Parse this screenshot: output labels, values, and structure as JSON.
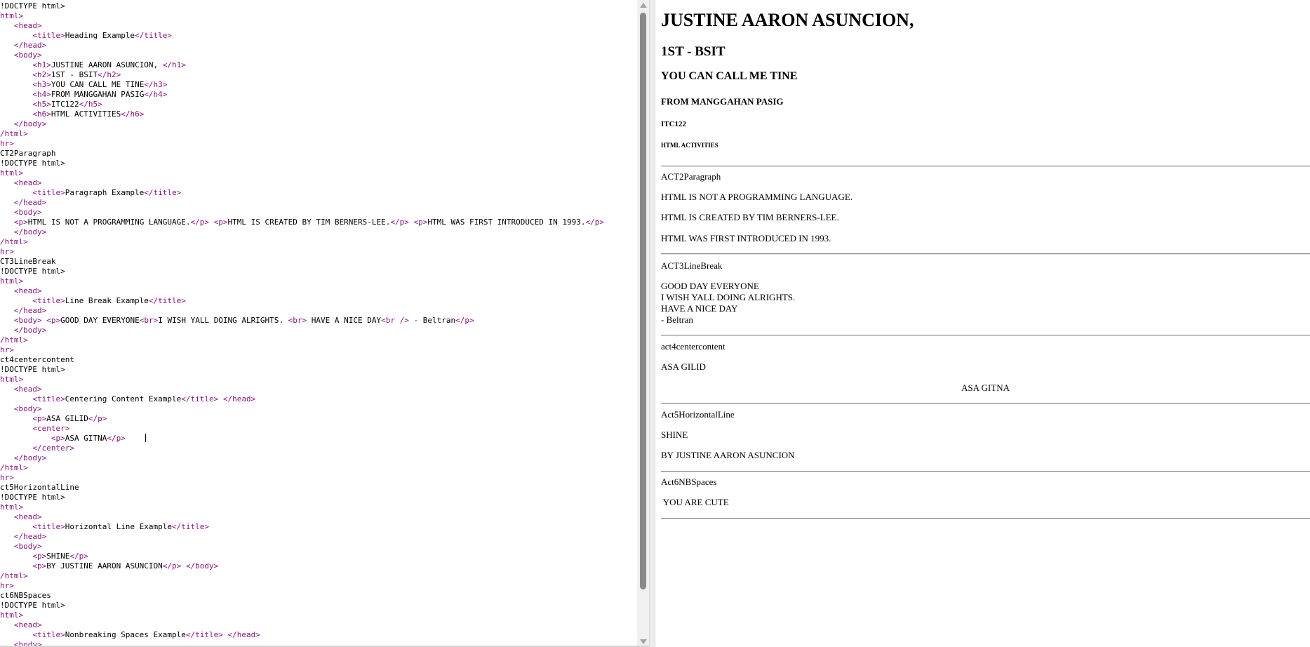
{
  "editor": {
    "lines": [
      [
        {
          "t": "!DOCTYPE html>",
          "c": "txt"
        }
      ],
      [
        {
          "t": "html>",
          "c": "tag"
        }
      ],
      [
        {
          "t": "   ",
          "c": "txt"
        },
        {
          "t": "<head>",
          "c": "tag"
        }
      ],
      [
        {
          "t": "       ",
          "c": "txt"
        },
        {
          "t": "<title>",
          "c": "tag"
        },
        {
          "t": "Heading Example",
          "c": "txt"
        },
        {
          "t": "</title>",
          "c": "tag"
        }
      ],
      [
        {
          "t": "   ",
          "c": "txt"
        },
        {
          "t": "</head>",
          "c": "tag"
        }
      ],
      [
        {
          "t": "   ",
          "c": "txt"
        },
        {
          "t": "<body>",
          "c": "tag"
        }
      ],
      [
        {
          "t": "       ",
          "c": "txt"
        },
        {
          "t": "<h1>",
          "c": "tag"
        },
        {
          "t": "JUSTINE AARON ASUNCION, ",
          "c": "txt"
        },
        {
          "t": "</h1>",
          "c": "tag"
        }
      ],
      [
        {
          "t": "       ",
          "c": "txt"
        },
        {
          "t": "<h2>",
          "c": "tag"
        },
        {
          "t": "1ST - BSIT",
          "c": "txt"
        },
        {
          "t": "</h2>",
          "c": "tag"
        }
      ],
      [
        {
          "t": "       ",
          "c": "txt"
        },
        {
          "t": "<h3>",
          "c": "tag"
        },
        {
          "t": "YOU CAN CALL ME TINE",
          "c": "txt"
        },
        {
          "t": "</h3>",
          "c": "tag"
        }
      ],
      [
        {
          "t": "       ",
          "c": "txt"
        },
        {
          "t": "<h4>",
          "c": "tag"
        },
        {
          "t": "FROM MANGGAHAN PASIG",
          "c": "txt"
        },
        {
          "t": "</h4>",
          "c": "tag"
        }
      ],
      [
        {
          "t": "       ",
          "c": "txt"
        },
        {
          "t": "<h5>",
          "c": "tag"
        },
        {
          "t": "ITC122",
          "c": "txt"
        },
        {
          "t": "</h5>",
          "c": "tag"
        }
      ],
      [
        {
          "t": "       ",
          "c": "txt"
        },
        {
          "t": "<h6>",
          "c": "tag"
        },
        {
          "t": "HTML ACTIVITIES",
          "c": "txt"
        },
        {
          "t": "</h6>",
          "c": "tag"
        }
      ],
      [
        {
          "t": "   ",
          "c": "txt"
        },
        {
          "t": "</body>",
          "c": "tag"
        }
      ],
      [
        {
          "t": "/html>",
          "c": "tag"
        }
      ],
      [
        {
          "t": "hr>",
          "c": "tag"
        }
      ],
      [
        {
          "t": "CT2Paragraph",
          "c": "txt"
        }
      ],
      [
        {
          "t": "!DOCTYPE html>",
          "c": "txt"
        }
      ],
      [
        {
          "t": "html>",
          "c": "tag"
        }
      ],
      [
        {
          "t": "   ",
          "c": "txt"
        },
        {
          "t": "<head>",
          "c": "tag"
        }
      ],
      [
        {
          "t": "       ",
          "c": "txt"
        },
        {
          "t": "<title>",
          "c": "tag"
        },
        {
          "t": "Paragraph Example",
          "c": "txt"
        },
        {
          "t": "</title>",
          "c": "tag"
        }
      ],
      [
        {
          "t": "   ",
          "c": "txt"
        },
        {
          "t": "</head>",
          "c": "tag"
        }
      ],
      [
        {
          "t": "   ",
          "c": "txt"
        },
        {
          "t": "<body>",
          "c": "tag"
        }
      ],
      [
        {
          "t": "   ",
          "c": "txt"
        },
        {
          "t": "<p>",
          "c": "tag"
        },
        {
          "t": "HTML IS NOT A PROGRAMMING LANGUAGE.",
          "c": "txt"
        },
        {
          "t": "</p>",
          "c": "tag"
        },
        {
          "t": " ",
          "c": "txt"
        },
        {
          "t": "<p>",
          "c": "tag"
        },
        {
          "t": "HTML IS CREATED BY TIM BERNERS-LEE.",
          "c": "txt"
        },
        {
          "t": "</p>",
          "c": "tag"
        },
        {
          "t": " ",
          "c": "txt"
        },
        {
          "t": "<p>",
          "c": "tag"
        },
        {
          "t": "HTML WAS FIRST INTRODUCED IN 1993.",
          "c": "txt"
        },
        {
          "t": "</p>",
          "c": "tag"
        }
      ],
      [
        {
          "t": "   ",
          "c": "txt"
        },
        {
          "t": "</body>",
          "c": "tag"
        }
      ],
      [
        {
          "t": "/html>",
          "c": "tag"
        }
      ],
      [
        {
          "t": "hr>",
          "c": "tag"
        }
      ],
      [
        {
          "t": "CT3LineBreak",
          "c": "txt"
        }
      ],
      [
        {
          "t": "!DOCTYPE html>",
          "c": "txt"
        }
      ],
      [
        {
          "t": "html>",
          "c": "tag"
        }
      ],
      [
        {
          "t": "   ",
          "c": "txt"
        },
        {
          "t": "<head>",
          "c": "tag"
        }
      ],
      [
        {
          "t": "       ",
          "c": "txt"
        },
        {
          "t": "<title>",
          "c": "tag"
        },
        {
          "t": "Line Break Example",
          "c": "txt"
        },
        {
          "t": "</title>",
          "c": "tag"
        }
      ],
      [
        {
          "t": "   ",
          "c": "txt"
        },
        {
          "t": "</head>",
          "c": "tag"
        }
      ],
      [
        {
          "t": "   ",
          "c": "txt"
        },
        {
          "t": "<body>",
          "c": "tag"
        },
        {
          "t": " ",
          "c": "txt"
        },
        {
          "t": "<p>",
          "c": "tag"
        },
        {
          "t": "GOOD DAY EVERYONE",
          "c": "txt"
        },
        {
          "t": "<br>",
          "c": "tag"
        },
        {
          "t": "I WISH YALL DOING ALRIGHTS. ",
          "c": "txt"
        },
        {
          "t": "<br>",
          "c": "tag"
        },
        {
          "t": " HAVE A NICE DAY",
          "c": "txt"
        },
        {
          "t": "<br />",
          "c": "tag"
        },
        {
          "t": " - Beltran",
          "c": "txt"
        },
        {
          "t": "</p>",
          "c": "tag"
        }
      ],
      [
        {
          "t": "   ",
          "c": "txt"
        },
        {
          "t": "</body>",
          "c": "tag"
        }
      ],
      [
        {
          "t": "/html>",
          "c": "tag"
        }
      ],
      [
        {
          "t": "hr>",
          "c": "tag"
        }
      ],
      [
        {
          "t": "ct4centercontent",
          "c": "txt"
        }
      ],
      [
        {
          "t": "!DOCTYPE html>",
          "c": "txt"
        }
      ],
      [
        {
          "t": "html>",
          "c": "tag"
        }
      ],
      [
        {
          "t": "   ",
          "c": "txt"
        },
        {
          "t": "<head>",
          "c": "tag"
        }
      ],
      [
        {
          "t": "       ",
          "c": "txt"
        },
        {
          "t": "<title>",
          "c": "tag"
        },
        {
          "t": "Centering Content Example",
          "c": "txt"
        },
        {
          "t": "</title>",
          "c": "tag"
        },
        {
          "t": " ",
          "c": "txt"
        },
        {
          "t": "</head>",
          "c": "tag"
        }
      ],
      [
        {
          "t": "   ",
          "c": "txt"
        },
        {
          "t": "<body>",
          "c": "tag"
        }
      ],
      [
        {
          "t": "       ",
          "c": "txt"
        },
        {
          "t": "<p>",
          "c": "tag"
        },
        {
          "t": "ASA GILID",
          "c": "txt"
        },
        {
          "t": "</p>",
          "c": "tag"
        }
      ],
      [
        {
          "t": "       ",
          "c": "txt"
        },
        {
          "t": "<center>",
          "c": "tag"
        }
      ],
      [
        {
          "t": "           ",
          "c": "txt"
        },
        {
          "t": "<p>",
          "c": "tag"
        },
        {
          "t": "ASA GITNA",
          "c": "txt"
        },
        {
          "t": "</p>",
          "c": "tag"
        },
        {
          "t": "CURSOR",
          "c": "cursor"
        }
      ],
      [
        {
          "t": "       ",
          "c": "txt"
        },
        {
          "t": "</center>",
          "c": "tag"
        }
      ],
      [
        {
          "t": "   ",
          "c": "txt"
        },
        {
          "t": "</body>",
          "c": "tag"
        }
      ],
      [
        {
          "t": "/html>",
          "c": "tag"
        }
      ],
      [
        {
          "t": "hr>",
          "c": "tag"
        }
      ],
      [
        {
          "t": "ct5HorizontalLine",
          "c": "txt"
        }
      ],
      [
        {
          "t": "!DOCTYPE html>",
          "c": "txt"
        }
      ],
      [
        {
          "t": "html>",
          "c": "tag"
        }
      ],
      [
        {
          "t": "   ",
          "c": "txt"
        },
        {
          "t": "<head>",
          "c": "tag"
        }
      ],
      [
        {
          "t": "       ",
          "c": "txt"
        },
        {
          "t": "<title>",
          "c": "tag"
        },
        {
          "t": "Horizontal Line Example",
          "c": "txt"
        },
        {
          "t": "</title>",
          "c": "tag"
        }
      ],
      [
        {
          "t": "   ",
          "c": "txt"
        },
        {
          "t": "</head>",
          "c": "tag"
        }
      ],
      [
        {
          "t": "   ",
          "c": "txt"
        },
        {
          "t": "<body>",
          "c": "tag"
        }
      ],
      [
        {
          "t": "       ",
          "c": "txt"
        },
        {
          "t": "<p>",
          "c": "tag"
        },
        {
          "t": "SHINE",
          "c": "txt"
        },
        {
          "t": "</p>",
          "c": "tag"
        }
      ],
      [
        {
          "t": "       ",
          "c": "txt"
        },
        {
          "t": "<p>",
          "c": "tag"
        },
        {
          "t": "BY JUSTINE AARON ASUNCION",
          "c": "txt"
        },
        {
          "t": "</p>",
          "c": "tag"
        },
        {
          "t": " ",
          "c": "txt"
        },
        {
          "t": "</body>",
          "c": "tag"
        }
      ],
      [
        {
          "t": "/html>",
          "c": "tag"
        }
      ],
      [
        {
          "t": "hr>",
          "c": "tag"
        }
      ],
      [
        {
          "t": "ct6NBSpaces",
          "c": "txt"
        }
      ],
      [
        {
          "t": "!DOCTYPE html>",
          "c": "txt"
        }
      ],
      [
        {
          "t": "html>",
          "c": "tag"
        }
      ],
      [
        {
          "t": "   ",
          "c": "txt"
        },
        {
          "t": "<head>",
          "c": "tag"
        }
      ],
      [
        {
          "t": "       ",
          "c": "txt"
        },
        {
          "t": "<title>",
          "c": "tag"
        },
        {
          "t": "Nonbreaking Spaces Example",
          "c": "txt"
        },
        {
          "t": "</title>",
          "c": "tag"
        },
        {
          "t": " ",
          "c": "txt"
        },
        {
          "t": "</head>",
          "c": "tag"
        }
      ],
      [
        {
          "t": "   ",
          "c": "txt"
        },
        {
          "t": "<body>",
          "c": "tag"
        }
      ]
    ]
  },
  "preview": {
    "h1": "JUSTINE AARON ASUNCION,",
    "h2": "1ST - BSIT",
    "h3": "YOU CAN CALL ME TINE",
    "h4": "FROM MANGGAHAN PASIG",
    "h5": "ITC122",
    "h6": "HTML ACTIVITIES",
    "act2": {
      "label": "ACT2Paragraph",
      "p1": "HTML IS NOT A PROGRAMMING LANGUAGE.",
      "p2": "HTML IS CREATED BY TIM BERNERS-LEE.",
      "p3": "HTML WAS FIRST INTRODUCED IN 1993."
    },
    "act3": {
      "label": "ACT3LineBreak",
      "l1": "GOOD DAY EVERYONE",
      "l2": "I WISH YALL DOING ALRIGHTS.",
      "l3": "HAVE A NICE DAY",
      "l4": "- Beltran"
    },
    "act4": {
      "label": "act4centercontent",
      "p1": "ASA GILID",
      "p2": "ASA GITNA"
    },
    "act5": {
      "label": "Act5HorizontalLine",
      "p1": "SHINE",
      "p2": "BY JUSTINE AARON ASUNCION"
    },
    "act6": {
      "label": "Act6NBSpaces",
      "p1": " YOU ARE CUTE"
    }
  },
  "colors": {
    "tag": "#881280",
    "text": "#000000",
    "scroll_thumb": "#8a8a8a"
  }
}
